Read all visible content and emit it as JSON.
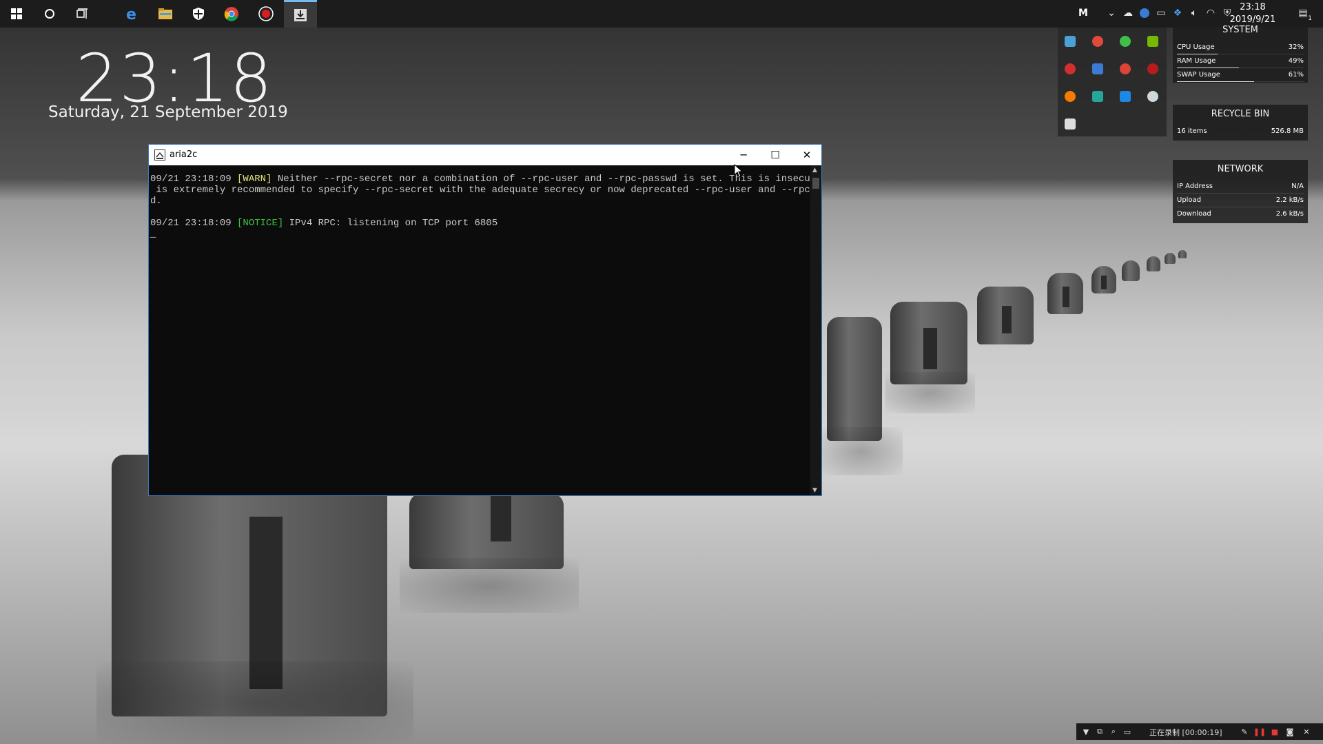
{
  "desktop": {
    "clock_widget": {
      "time": "23:18",
      "date": "Saturday, 21 September 2019"
    }
  },
  "taskbar": {
    "pinned": [
      {
        "name": "start",
        "icon": "windows-logo-icon"
      },
      {
        "name": "search",
        "icon": "cortana-circle-icon"
      },
      {
        "name": "task-view",
        "icon": "task-view-icon"
      },
      {
        "name": "edge",
        "icon": "edge-icon"
      },
      {
        "name": "file-explorer",
        "icon": "folder-icon"
      },
      {
        "name": "security",
        "icon": "shield-icon"
      },
      {
        "name": "chrome",
        "icon": "chrome-icon"
      },
      {
        "name": "recorder",
        "icon": "record-icon"
      },
      {
        "name": "aria2c",
        "icon": "download-tray-icon",
        "active": true
      }
    ],
    "tray": {
      "time": "23:18",
      "date": "2019/9/21",
      "notifications_count": "1"
    }
  },
  "console_window": {
    "title": "aria2c",
    "controls": {
      "minimize": "─",
      "maximize": "☐",
      "close": "✕"
    },
    "lines": [
      {
        "ts": "09/21 23:18:09",
        "level": "[WARN]",
        "text": " Neither --rpc-secret nor a combination of --rpc-user and --rpc-passwd is set. This is insecure. It"
      },
      {
        "text": " is extremely recommended to specify --rpc-secret with the adequate secrecy or now deprecated --rpc-user and --rpc-passw"
      },
      {
        "text": "d."
      },
      {
        "ts": "09/21 23:18:09",
        "level": "[NOTICE]",
        "text": " IPv4 RPC: listening on TCP port 6805"
      }
    ],
    "cursor": "_"
  },
  "widgets": {
    "system": {
      "title": "SYSTEM",
      "rows": [
        {
          "label": "CPU Usage",
          "value": "32%",
          "level": 0.32
        },
        {
          "label": "RAM Usage",
          "value": "49%",
          "level": 0.49
        },
        {
          "label": "SWAP Usage",
          "value": "61%",
          "level": 0.61
        }
      ]
    },
    "recycle_bin": {
      "title": "RECYCLE BIN",
      "items": "16 items",
      "size": "526.8 MB"
    },
    "network": {
      "title": "NETWORK",
      "rows": [
        {
          "label": "IP Address",
          "value": "N/A"
        },
        {
          "label": "Upload",
          "value": "2.2 kB/s"
        },
        {
          "label": "Download",
          "value": "2.6 kB/s"
        }
      ]
    }
  },
  "recording_bar": {
    "status": "正在录制 [00:00:19]"
  },
  "colors": {
    "warn": "#e5e57a",
    "notice": "#3cc63c",
    "console_bg": "#0c0c0c",
    "taskbar_bg": "#1c1c1c",
    "accent": "#76b9ed"
  }
}
